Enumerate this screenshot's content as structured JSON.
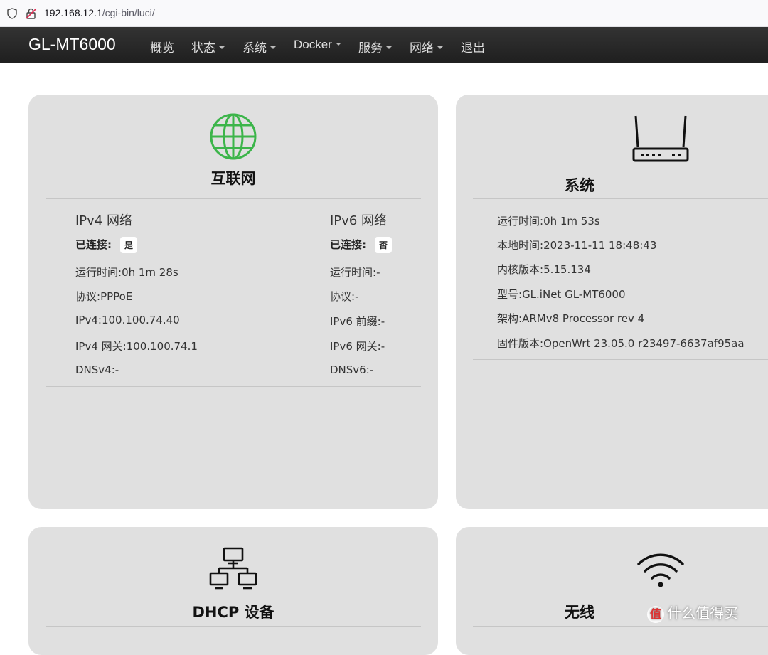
{
  "browser": {
    "url_host": "192.168.12.1",
    "url_path": "/cgi-bin/luci/"
  },
  "navbar": {
    "brand": "GL-MT6000",
    "items": [
      {
        "label": "概览"
      },
      {
        "label": "状态"
      },
      {
        "label": "系统"
      },
      {
        "label": "Docker"
      },
      {
        "label": "服务"
      },
      {
        "label": "网络"
      },
      {
        "label": "退出"
      }
    ]
  },
  "internet": {
    "title": "互联网",
    "ipv4": {
      "heading": "IPv4 网络",
      "connected_label": "已连接:",
      "connected_value": "是",
      "uptime_label": "运行时间:",
      "uptime_value": "0h 1m 28s",
      "protocol_label": "协议:",
      "protocol_value": "PPPoE",
      "ip_label": "IPv4:",
      "ip_value": "100.100.74.40",
      "gateway_label": "IPv4 网关:",
      "gateway_value": "100.100.74.1",
      "dns_label": "DNSv4:",
      "dns_value": "-"
    },
    "ipv6": {
      "heading": "IPv6 网络",
      "connected_label": "已连接:",
      "connected_value": "否",
      "uptime_label": "运行时间:",
      "uptime_value": "-",
      "protocol_label": "协议:",
      "protocol_value": "-",
      "prefix_label": "IPv6 前缀:",
      "prefix_value": "-",
      "gateway_label": "IPv6 网关:",
      "gateway_value": "-",
      "dns_label": "DNSv6:",
      "dns_value": "-"
    }
  },
  "system": {
    "title": "系统",
    "rows": [
      {
        "label": "运行时间:",
        "value": "0h 1m 53s"
      },
      {
        "label": "本地时间:",
        "value": "2023-11-11 18:48:43"
      },
      {
        "label": "内核版本:",
        "value": "5.15.134"
      },
      {
        "label": "型号:",
        "value": "GL.iNet GL-MT6000"
      },
      {
        "label": "架构:",
        "value": "ARMv8 Processor rev 4"
      },
      {
        "label": "固件版本:",
        "value": "OpenWrt 23.05.0 r23497-6637af95aa"
      }
    ]
  },
  "dhcp": {
    "title": "DHCP 设备"
  },
  "wireless": {
    "title": "无线"
  },
  "watermark": {
    "text": "值 什么值得买",
    "badge": "值"
  },
  "colors": {
    "globe": "#3cb54a",
    "navbar": "#2a2a2a",
    "card": "#e0e0e0"
  }
}
